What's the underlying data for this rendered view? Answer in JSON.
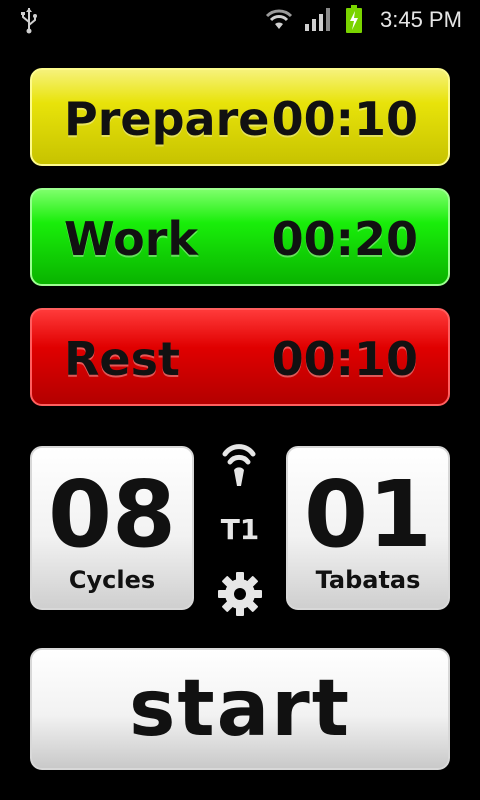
{
  "status_bar": {
    "time": "3:45 PM",
    "icons": [
      "usb-icon",
      "wifi-icon",
      "signal-icon",
      "battery-charging-icon"
    ]
  },
  "phases": [
    {
      "label": "Prepare",
      "value": "00:10",
      "color": "#e8e30a"
    },
    {
      "label": "Work",
      "value": "00:20",
      "color": "#19ee0a"
    },
    {
      "label": "Rest",
      "value": "00:10",
      "color": "#e00000"
    }
  ],
  "counters": {
    "cycles": {
      "value": "08",
      "label": "Cycles"
    },
    "tabatas": {
      "value": "01",
      "label": "Tabatas"
    }
  },
  "middle": {
    "profile": "T1",
    "icons": [
      "wireless-icon",
      "gear-icon"
    ]
  },
  "start_button": {
    "label": "start"
  }
}
